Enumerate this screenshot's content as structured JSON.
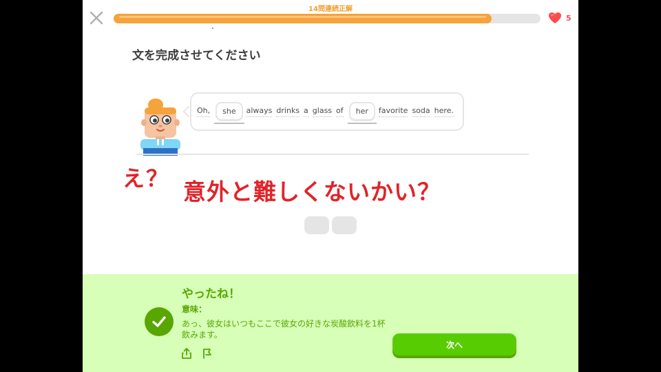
{
  "header": {
    "streak_label": "14問連続正解",
    "progress": 0.885,
    "hearts_count": "5",
    "close_icon": "close-icon",
    "heart_icon": "heart-icon"
  },
  "exercise": {
    "instruction": "文を完成させてください",
    "sentence": {
      "w1": "Oh,",
      "blank1": "she",
      "w2": "always",
      "w3": "drinks",
      "w4": "a",
      "w5": "glass",
      "w6": "of",
      "blank2": "her",
      "w7": "favorite",
      "w8": "soda",
      "w9": "here."
    }
  },
  "overlay": {
    "text_a": "え？",
    "text_b": "意外と難しくないかい？"
  },
  "feedback": {
    "title": "やったね！",
    "meaning_label": "意味：",
    "meaning": "あっ、彼女はいつもここで彼女の好きな炭酸飲料を1杯飲みます。",
    "next_button": "次へ",
    "check_icon": "check-icon",
    "share_icon": "share-icon",
    "flag_icon": "flag-icon"
  },
  "colors": {
    "progress": "#f5a33b",
    "heart": "#ff4b4b",
    "feedback_bg": "#d7ffb8",
    "success": "#58a700",
    "button": "#58cc02",
    "overlay_text": "#e0242a"
  }
}
